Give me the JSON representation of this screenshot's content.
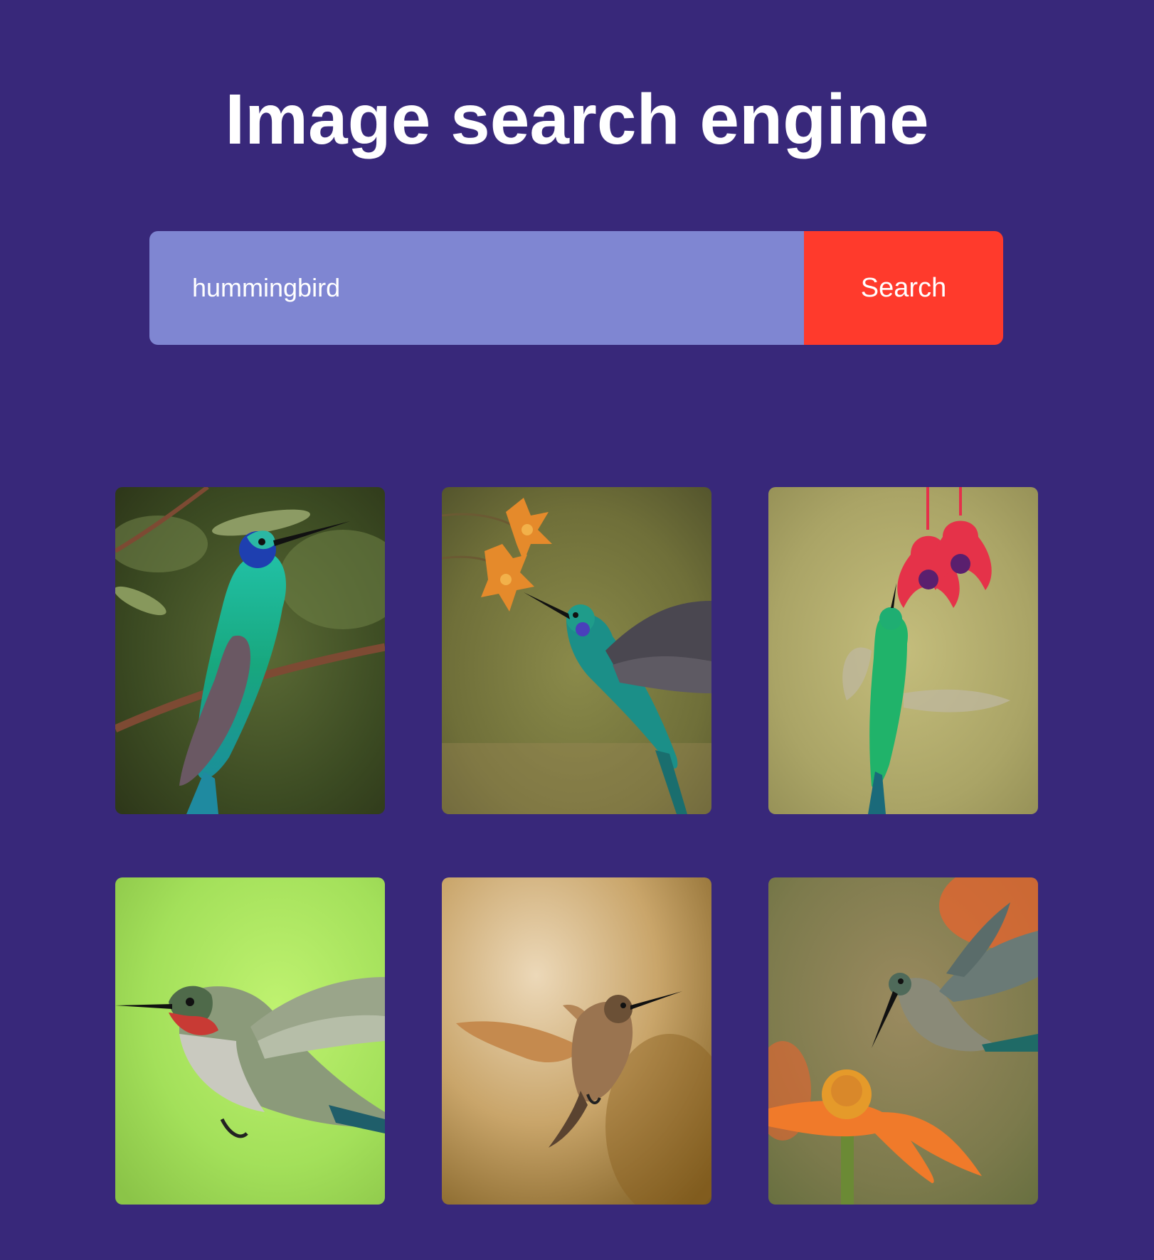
{
  "header": {
    "title": "Image search engine"
  },
  "search": {
    "value": "hummingbird",
    "button_label": "Search"
  },
  "colors": {
    "background": "#38287a",
    "input_background": "#7f86d2",
    "button_background": "#ff3a2c",
    "text": "#ffffff"
  },
  "results": [
    {
      "icon": "hummingbird-perched-on-branch-image"
    },
    {
      "icon": "hummingbird-hovering-at-orange-flowers-image"
    },
    {
      "icon": "hummingbird-feeding-from-red-fuchsia-image"
    },
    {
      "icon": "ruby-throated-hummingbird-on-green-image"
    },
    {
      "icon": "brown-hummingbird-in-flight-image"
    },
    {
      "icon": "hummingbird-at-orange-flower-image"
    }
  ]
}
